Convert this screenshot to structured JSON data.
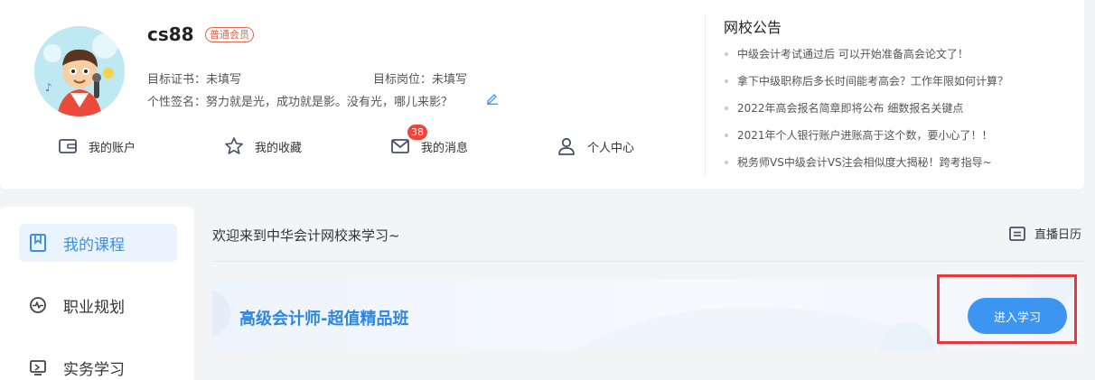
{
  "profile": {
    "username": "cs88",
    "member_badge": "普通会员",
    "target_cert_label": "目标证书：",
    "target_cert_value": "未填写",
    "target_job_label": "目标岗位：",
    "target_job_value": "未填写",
    "signature_label": "个性签名：",
    "signature_value": "努力就是光，成功就是影。没有光，哪儿来影？"
  },
  "shortcuts": [
    {
      "label": "我的账户",
      "icon": "wallet-icon"
    },
    {
      "label": "我的收藏",
      "icon": "star-icon"
    },
    {
      "label": "我的消息",
      "icon": "mail-icon",
      "badge": "38"
    },
    {
      "label": "个人中心",
      "icon": "user-icon"
    }
  ],
  "notices": {
    "title": "网校公告",
    "items": [
      "中级会计考试通过后 可以开始准备高会论文了！",
      "拿下中级职称后多长时间能考高会？工作年限如何计算？",
      "2022年高会报名简章即将公布 细数报名关键点",
      "2021年个人银行账户进账高于这个数，要小心了！！",
      "税务师VS中级会计VS注会相似度大揭秘！跨考指导~"
    ]
  },
  "sidebar": {
    "items": [
      {
        "label": "我的课程",
        "icon": "bookmark-icon",
        "active": true
      },
      {
        "label": "职业规划",
        "icon": "pulse-icon",
        "active": false
      },
      {
        "label": "实务学习",
        "icon": "screen-icon",
        "active": false
      }
    ]
  },
  "main": {
    "welcome": "欢迎来到中华会计网校来学习~",
    "live_calendar": "直播日历",
    "course": {
      "name": "高级会计师-超值精品班",
      "button": "进入学习"
    }
  },
  "colors": {
    "accent": "#3b95f1",
    "course_title": "#2f86e2",
    "badge_red": "#f0443a",
    "highlight": "#e5393d"
  }
}
